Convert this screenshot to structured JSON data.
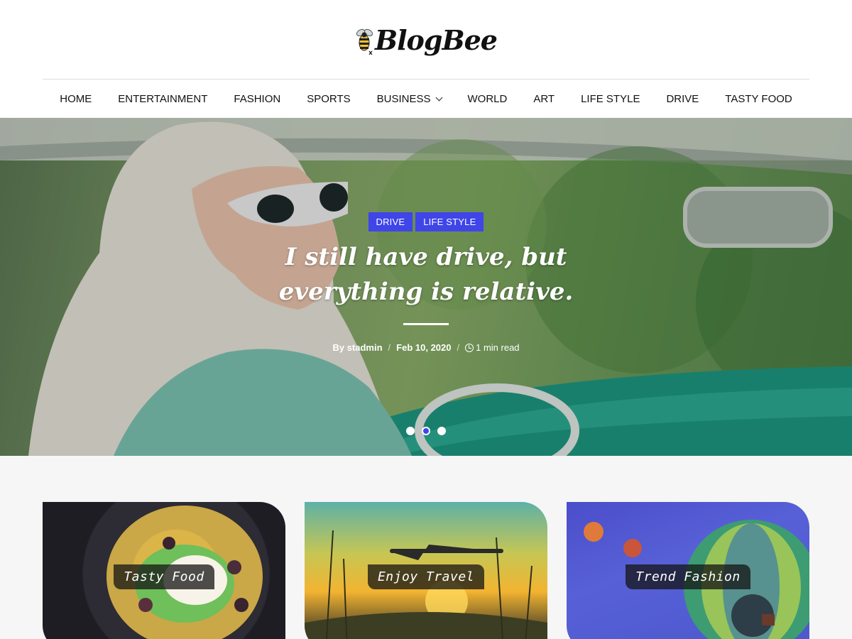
{
  "header": {
    "logo_text": "BlogBee",
    "logo_icon": "bee-icon"
  },
  "nav": {
    "items": [
      {
        "label": "HOME"
      },
      {
        "label": "ENTERTAINMENT"
      },
      {
        "label": "FASHION"
      },
      {
        "label": "SPORTS"
      },
      {
        "label": "BUSINESS",
        "has_dropdown": true
      },
      {
        "label": "WORLD"
      },
      {
        "label": "ART"
      },
      {
        "label": "LIFE STYLE"
      },
      {
        "label": "DRIVE"
      },
      {
        "label": "TASTY FOOD"
      }
    ]
  },
  "hero": {
    "categories": [
      "DRIVE",
      "LIFE STYLE"
    ],
    "title": "I still have drive, but everything is relative.",
    "author": "By stadmin",
    "date": "Feb 10, 2020",
    "read_time": "1 min read",
    "slider": {
      "count": 3,
      "active": 2
    }
  },
  "cards": [
    {
      "label": "Tasty Food"
    },
    {
      "label": "Enjoy Travel"
    },
    {
      "label": "Trend Fashion"
    }
  ],
  "colors": {
    "accent": "#3f45e8",
    "text": "#111111",
    "section_bg": "#f6f6f6"
  }
}
